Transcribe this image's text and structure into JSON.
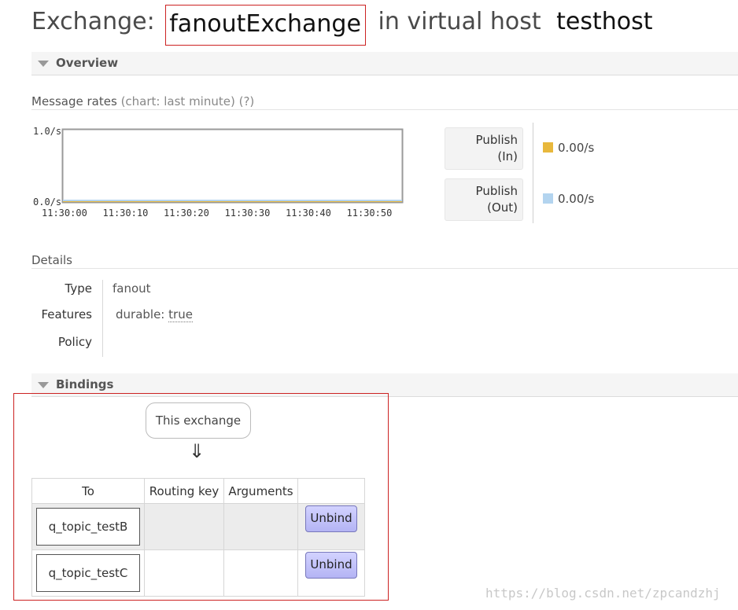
{
  "title": {
    "prefix": "Exchange:",
    "name": "fanoutExchange",
    "middle": "in virtual host",
    "vhost": "testhost"
  },
  "overview": {
    "header": "Overview",
    "message_rates_label": "Message rates",
    "message_rates_qualifier": "(chart: last minute)",
    "help": "(?)",
    "rates": [
      {
        "label_line1": "Publish",
        "label_line2": "(In)",
        "value": "0.00/s",
        "color": "#e8b83c"
      },
      {
        "label_line1": "Publish",
        "label_line2": "(Out)",
        "value": "0.00/s",
        "color": "#b3d4ef"
      }
    ]
  },
  "chart_data": {
    "type": "line",
    "y_top_label": "1.0/s",
    "y_bottom_label": "0.0/s",
    "ylim": [
      0,
      1
    ],
    "x_ticks": [
      "11:30:00",
      "11:30:10",
      "11:30:20",
      "11:30:30",
      "11:30:40",
      "11:30:50"
    ],
    "series": [
      {
        "name": "Publish (In)",
        "color": "#e8b83c",
        "values": [
          0,
          0,
          0,
          0,
          0,
          0
        ]
      },
      {
        "name": "Publish (Out)",
        "color": "#b3d4ef",
        "values": [
          0,
          0,
          0,
          0,
          0,
          0
        ]
      }
    ]
  },
  "details": {
    "header": "Details",
    "type_key": "Type",
    "type_value": "fanout",
    "features_key": "Features",
    "features_name": "durable:",
    "features_value": "true",
    "policy_key": "Policy"
  },
  "bindings": {
    "header": "Bindings",
    "this_exchange": "This exchange",
    "arrow": "⇓",
    "columns": [
      "To",
      "Routing key",
      "Arguments",
      ""
    ],
    "rows": [
      {
        "to": "q_topic_testB",
        "routing_key": "",
        "arguments": "",
        "action": "Unbind"
      },
      {
        "to": "q_topic_testC",
        "routing_key": "",
        "arguments": "",
        "action": "Unbind"
      }
    ]
  },
  "watermark": "https://blog.csdn.net/zpcandzhj"
}
